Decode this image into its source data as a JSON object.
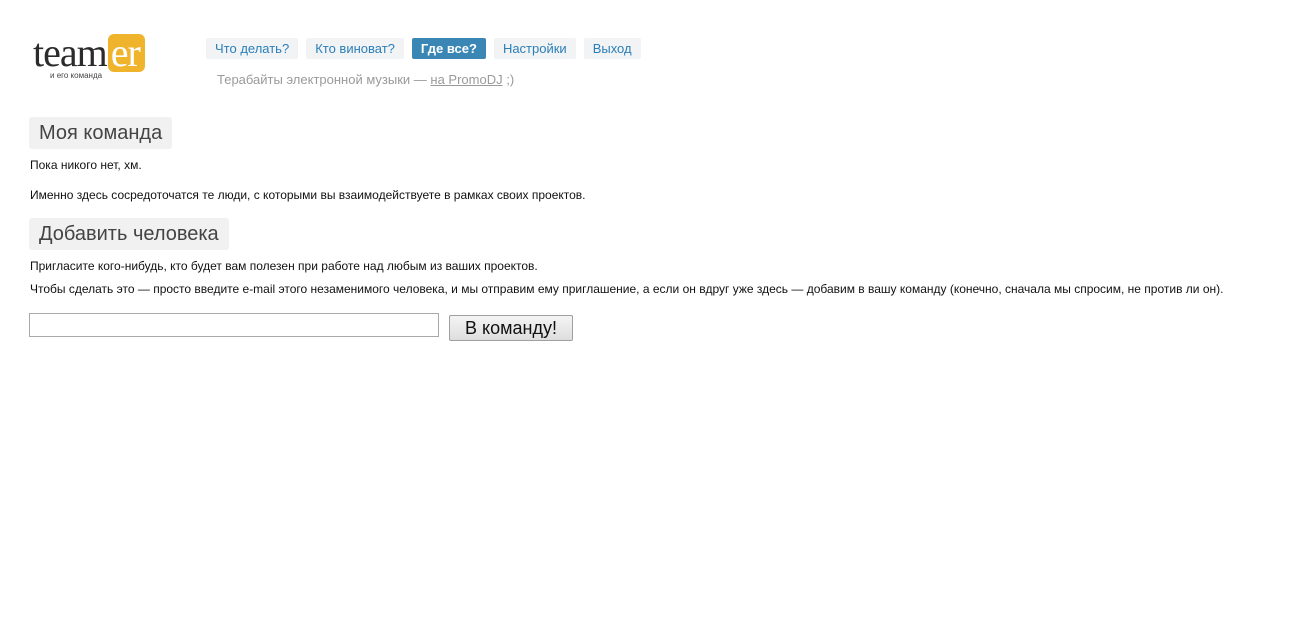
{
  "logo": {
    "word_main": "team",
    "word_accent": "er",
    "tagline": "и его команда",
    "accent_color": "#f0b42c"
  },
  "nav": {
    "items": [
      {
        "label": "Что делать?",
        "active": false
      },
      {
        "label": "Кто виноват?",
        "active": false
      },
      {
        "label": "Где все?",
        "active": true
      },
      {
        "label": "Настройки",
        "active": false
      },
      {
        "label": "Выход",
        "active": false
      }
    ],
    "link_color": "#2b7fb8",
    "active_color": "#3a87b5"
  },
  "slogan": {
    "text": "Терабайты электронной музыки — ",
    "link": "на PromoDJ",
    "suffix": " ;)"
  },
  "team_section": {
    "title": "Моя команда",
    "empty_text": "Пока никого нет, хм.",
    "description": "Именно здесь сосредоточатся те люди, с которыми вы взаимодействуете в рамках своих проектов."
  },
  "add_section": {
    "title": "Добавить человека",
    "line1": "Пригласите кого-нибудь, кто будет вам полезен при работе над любым из ваших проектов.",
    "line2": "Чтобы сделать это — просто введите e-mail этого незаменимого человека, и мы отправим ему приглашение, а если он вдруг уже здесь — добавим в вашу команду (конечно, сначала мы спросим, не против ли он).",
    "email_value": "",
    "submit_label": "В команду!"
  }
}
